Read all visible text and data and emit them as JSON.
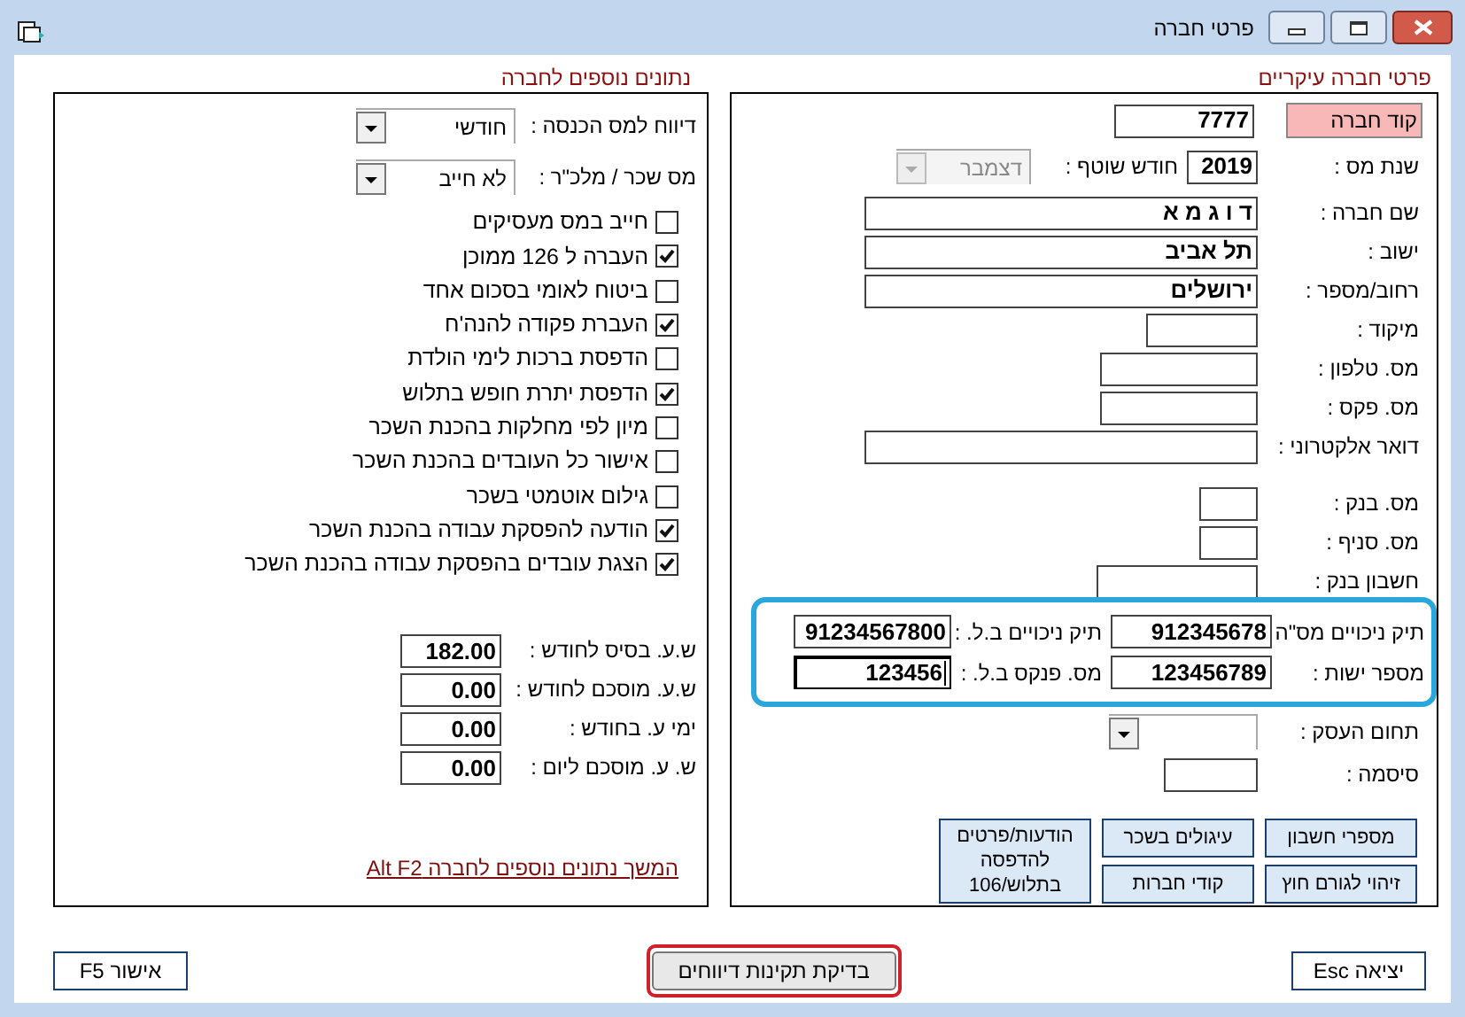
{
  "window": {
    "title": "פרטי חברה"
  },
  "main_panel": {
    "title": "פרטי חברה עיקריים",
    "company_code": {
      "label": "קוד חברה",
      "value": "7777",
      "highlighted": true
    },
    "tax_year": {
      "label": "שנת מס :",
      "value": "2019"
    },
    "current_month": {
      "label": "חודש שוטף :",
      "value": "דצמבר",
      "disabled": true
    },
    "fields": [
      {
        "label": "שם חברה :",
        "value": "ד ו ג מ א"
      },
      {
        "label": "ישוב :",
        "value": "תל אביב"
      },
      {
        "label": "רחוב/מספר :",
        "value": "ירושלים"
      },
      {
        "label": "מיקוד :"
      },
      {
        "label": "מס. טלפון :"
      },
      {
        "label": "מס. פקס :"
      },
      {
        "label": "דואר אלקטרוני :"
      },
      {
        "label": "מס. בנק :"
      },
      {
        "label": "מס. סניף :"
      },
      {
        "label": "חשבון בנק :"
      }
    ],
    "tax_ids": {
      "highlighted": true,
      "rows": [
        [
          {
            "label": "תיק ניכויים מס\"ה",
            "value": "912345678",
            "focused": false
          },
          {
            "label": "תיק ניכויים ב.ל. :",
            "value": "91234567800",
            "focused": false
          }
        ],
        [
          {
            "label": "מספר ישות :",
            "value": "123456789",
            "focused": false
          },
          {
            "label": "מס. פנקס ב.ל. :",
            "value": "123456",
            "focused": true
          }
        ]
      ]
    },
    "business_field": {
      "label": "תחום העסק :"
    },
    "password": {
      "label": "סיסמה :"
    },
    "buttons": [
      "מספרי חשבון",
      "זיהוי לגורם חוץ",
      "עיגולים בשכר",
      "קודי חברות",
      "הודעות/פרטים להדפסה בתלוש/106"
    ]
  },
  "extra_panel": {
    "title": "נתונים נוספים לחברה",
    "selects": [
      {
        "label": "דיווח למס הכנסה :",
        "value": "חודשי"
      },
      {
        "label": "מס שכר / מלכ\"ר :",
        "value": "לא חייב"
      }
    ],
    "options": [
      {
        "label": "חייב במס מעסיקים",
        "checked": false
      },
      {
        "label": "העברה ל 126 ממוכן",
        "checked": true
      },
      {
        "label": "ביטוח לאומי בסכום אחד",
        "checked": false
      },
      {
        "label": "העברת פקודה להנה'ח",
        "checked": true
      },
      {
        "label": "הדפסת ברכות לימי הולדת",
        "checked": false
      },
      {
        "label": "הדפסת יתרת חופש בתלוש",
        "checked": true
      },
      {
        "label": "מיון לפי מחלקות בהכנת השכר",
        "checked": false
      },
      {
        "label": "אישור כל העובדים בהכנת השכר",
        "checked": false
      },
      {
        "label": "גילום אוטמטי בשכר",
        "checked": false
      },
      {
        "label": "הודעה להפסקת עבודה בהכנת השכר",
        "checked": true
      },
      {
        "label": "הצגת עובדים בהפסקת עבודה בהכנת השכר",
        "checked": true
      }
    ],
    "hours": [
      {
        "label": "ש.ע. בסיס לחודש :",
        "value": "182.00"
      },
      {
        "label": "ש.ע. מוסכם לחודש :",
        "value": "0.00"
      },
      {
        "label": "ימי ע. בחודש :",
        "value": "0.00"
      },
      {
        "label": "ש. ע. מוסכם ליום :",
        "value": "0.00"
      }
    ],
    "link": "המשך נתונים נוספים לחברה  Alt F2"
  },
  "footer_buttons": [
    {
      "label": "יציאה Esc",
      "focused": false
    },
    {
      "label": "בדיקת תקינות דיווחים",
      "focused": true
    },
    {
      "label": "אישור F5",
      "focused": false
    }
  ]
}
